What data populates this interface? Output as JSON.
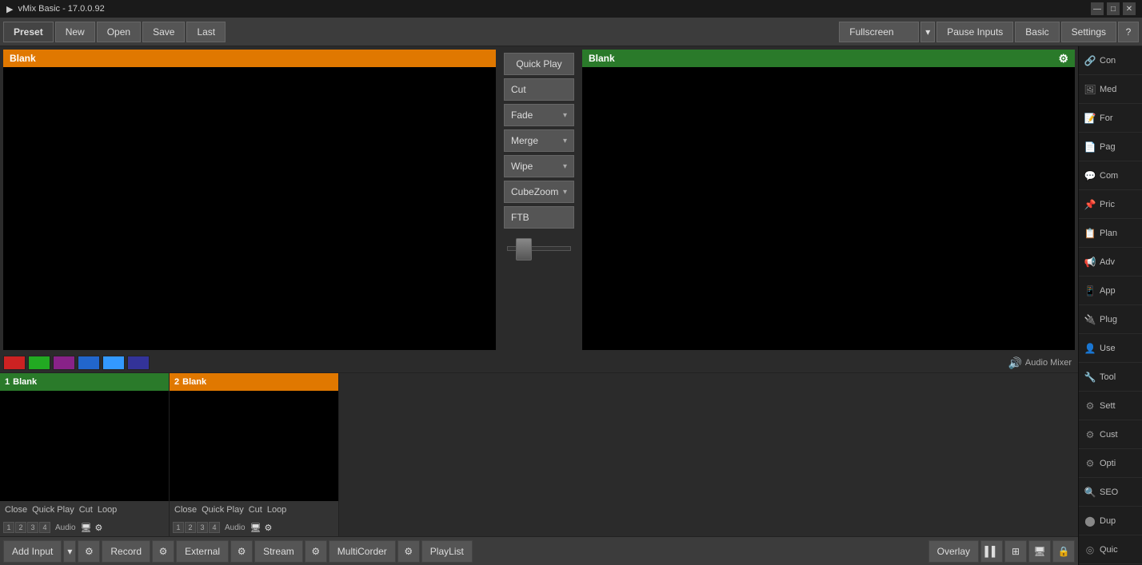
{
  "app": {
    "title": "vMix Basic - 17.0.0.92",
    "icon": "▶"
  },
  "titlebar": {
    "minimize": "—",
    "maximize": "□",
    "close": "✕"
  },
  "toolbar": {
    "preset_label": "Preset",
    "new_label": "New",
    "open_label": "Open",
    "save_label": "Save",
    "last_label": "Last",
    "fullscreen_label": "Fullscreen",
    "pause_inputs_label": "Pause Inputs",
    "basic_label": "Basic",
    "settings_label": "Settings",
    "help_label": "?"
  },
  "preview": {
    "label": "Blank",
    "color": "orange"
  },
  "program": {
    "label": "Blank",
    "color": "green"
  },
  "transitions": {
    "quick_play": "Quick Play",
    "cut": "Cut",
    "fade": "Fade",
    "merge": "Merge",
    "wipe": "Wipe",
    "cubezoom": "CubeZoom",
    "ftb": "FTB"
  },
  "color_buttons": [
    {
      "color": "#cc2222",
      "id": "red"
    },
    {
      "color": "#22aa22",
      "id": "green"
    },
    {
      "color": "#882288",
      "id": "purple"
    },
    {
      "color": "#2266cc",
      "id": "blue"
    },
    {
      "color": "#3399ff",
      "id": "lightblue"
    },
    {
      "color": "#333399",
      "id": "darkblue"
    }
  ],
  "audio_mixer": {
    "label": "Audio Mixer"
  },
  "inputs": [
    {
      "num": "1",
      "label": "Blank",
      "color": "green",
      "close": "Close",
      "quick_play": "Quick Play",
      "cut": "Cut",
      "loop": "Loop",
      "tabs": [
        "1",
        "2",
        "3",
        "4"
      ],
      "audio": "Audio"
    },
    {
      "num": "2",
      "label": "Blank",
      "color": "orange",
      "close": "Close",
      "quick_play": "Quick Play",
      "cut": "Cut",
      "loop": "Loop",
      "tabs": [
        "1",
        "2",
        "3",
        "4"
      ],
      "audio": "Audio"
    }
  ],
  "bottom_bar": {
    "add_input": "Add Input",
    "record": "Record",
    "external": "External",
    "stream": "Stream",
    "multicorder": "MultiCorder",
    "playlist": "PlayList",
    "overlay": "Overlay"
  },
  "right_panel": {
    "items": [
      {
        "label": "Con",
        "icon": "con"
      },
      {
        "label": "Med",
        "icon": "media"
      },
      {
        "label": "For",
        "icon": "form"
      },
      {
        "label": "Pag",
        "icon": "page"
      },
      {
        "label": "Com",
        "icon": "comment"
      },
      {
        "label": "Pric",
        "icon": "pricing"
      },
      {
        "label": "Plan",
        "icon": "plan"
      },
      {
        "label": "Adv",
        "icon": "adv"
      },
      {
        "label": "App",
        "icon": "app"
      },
      {
        "label": "Plug",
        "icon": "plugin"
      },
      {
        "label": "Use",
        "icon": "user"
      },
      {
        "label": "Tool",
        "icon": "tool"
      },
      {
        "label": "Sett",
        "icon": "settings2"
      },
      {
        "label": "Cust",
        "icon": "custom"
      },
      {
        "label": "Opti",
        "icon": "options"
      },
      {
        "label": "SEO",
        "icon": "seo"
      },
      {
        "label": "Dup",
        "icon": "duplicate"
      },
      {
        "label": "Quic",
        "icon": "quick"
      }
    ]
  }
}
